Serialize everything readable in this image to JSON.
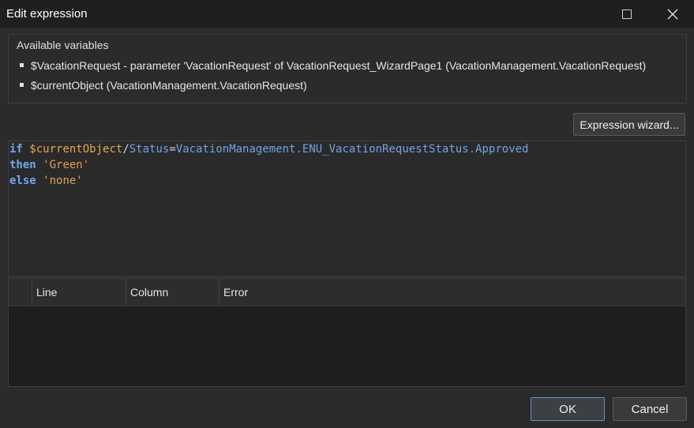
{
  "window": {
    "title": "Edit expression",
    "controls": {
      "maximize_icon": "maximize-icon",
      "close_icon": "close-icon"
    }
  },
  "variables": {
    "legend": "Available variables",
    "items": [
      "$VacationRequest - parameter 'VacationRequest' of VacationRequest_WizardPage1 (VacationManagement.VacationRequest)",
      "$currentObject (VacationManagement.VacationRequest)"
    ]
  },
  "toolbar": {
    "wizard_label": "Expression wizard..."
  },
  "editor": {
    "lines": [
      {
        "tokens": [
          {
            "type": "kw",
            "text": "if"
          },
          {
            "type": "op",
            "text": " "
          },
          {
            "type": "var",
            "text": "$currentObject"
          },
          {
            "type": "op",
            "text": "/"
          },
          {
            "type": "attr",
            "text": "Status"
          },
          {
            "type": "op",
            "text": "="
          },
          {
            "type": "enum",
            "text": "VacationManagement.ENU_VacationRequestStatus.Approved"
          }
        ]
      },
      {
        "tokens": [
          {
            "type": "kw",
            "text": "then"
          },
          {
            "type": "op",
            "text": " "
          },
          {
            "type": "str",
            "text": "'Green'"
          }
        ]
      },
      {
        "tokens": [
          {
            "type": "kw",
            "text": "else"
          },
          {
            "type": "op",
            "text": " "
          },
          {
            "type": "str",
            "text": "'none'"
          }
        ]
      }
    ]
  },
  "errors": {
    "columns": [
      "Line",
      "Column",
      "Error"
    ],
    "rows": []
  },
  "buttons": {
    "ok": "OK",
    "cancel": "Cancel"
  },
  "colors": {
    "keyword": "#6fa8f5",
    "variable": "#e3a948",
    "string": "#e0a050",
    "enum": "#6fa3e6",
    "accent_border": "#6a8fc7"
  }
}
